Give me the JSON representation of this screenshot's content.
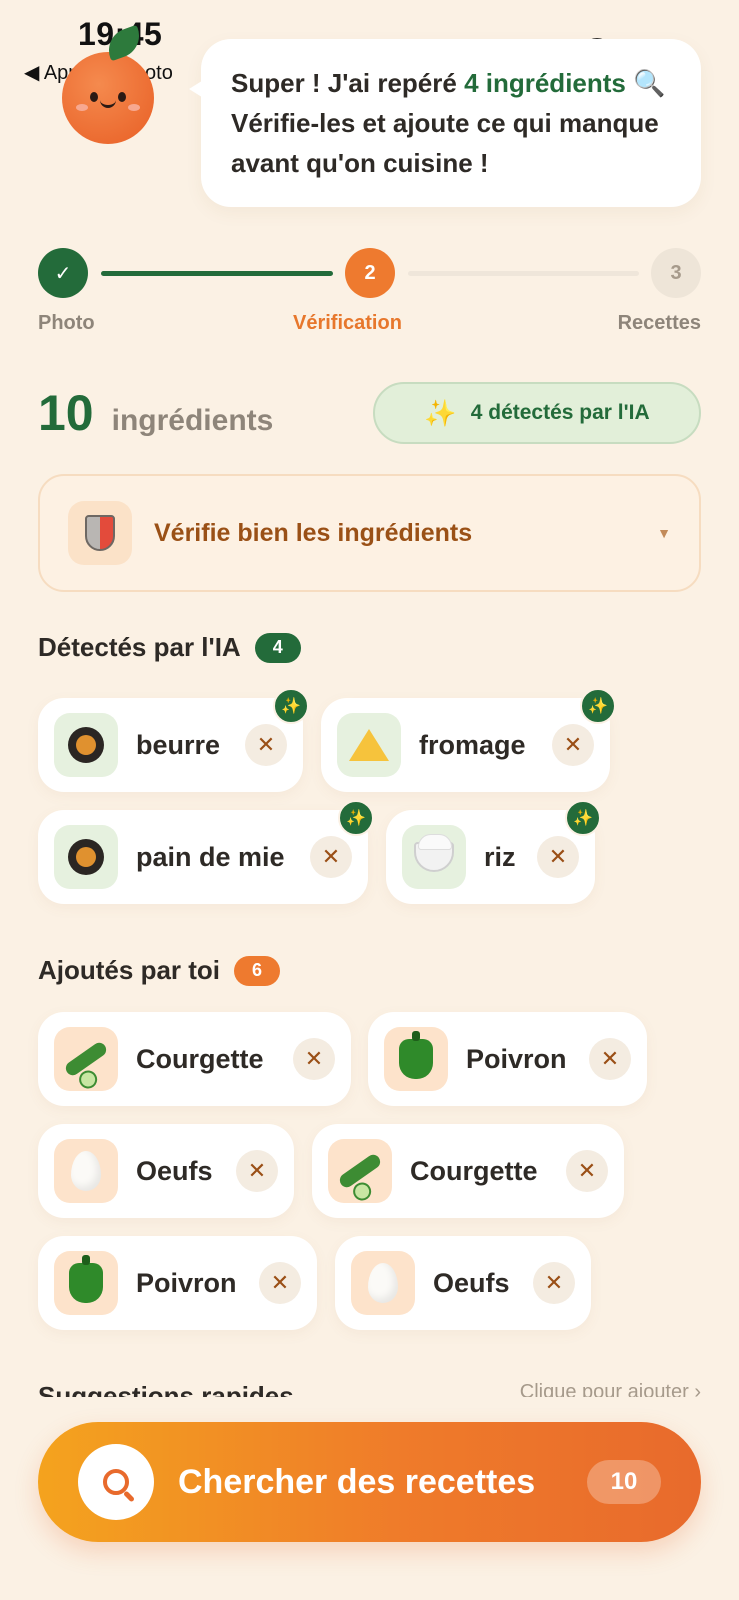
{
  "status_bar": {
    "time": "19:45",
    "back_label": "◀ Appareil photo"
  },
  "bubble": {
    "before": "Super ! J'ai repéré ",
    "highlight": "4 ingrédients",
    "line2_icon": "🔍",
    "after": " Vérifie-les et ajoute ce qui manque avant qu'on cuisine !"
  },
  "stepper": {
    "steps": [
      {
        "label": "Photo",
        "marker": "✓",
        "state": "done"
      },
      {
        "label": "Vérification",
        "marker": "2",
        "state": "active"
      },
      {
        "label": "Recettes",
        "marker": "3",
        "state": "pending"
      }
    ]
  },
  "summary": {
    "count": "10",
    "count_label": "ingrédients",
    "ai_pill_icon": "✨",
    "ai_pill": "4 détectés par l'IA"
  },
  "warning": {
    "label": "Vérifie bien les ingrédients",
    "caret": "▼"
  },
  "detected": {
    "title": "Détectés par l'IA",
    "badge": "4",
    "items": [
      {
        "label": "beurre",
        "icon": "pan-icon"
      },
      {
        "label": "fromage",
        "icon": "cheese-icon"
      },
      {
        "label": "pain de mie",
        "icon": "pan-icon"
      },
      {
        "label": "riz",
        "icon": "rice-bowl-icon"
      }
    ]
  },
  "added": {
    "title": "Ajoutés par toi",
    "badge": "6",
    "items": [
      {
        "label": "Courgette",
        "icon": "zucchini-icon"
      },
      {
        "label": "Poivron",
        "icon": "pepper-icon"
      },
      {
        "label": "Oeufs",
        "icon": "egg-icon"
      },
      {
        "label": "Courgette",
        "icon": "zucchini-icon"
      },
      {
        "label": "Poivron",
        "icon": "pepper-icon"
      },
      {
        "label": "Oeufs",
        "icon": "egg-icon"
      }
    ]
  },
  "suggestions": {
    "title": "Suggestions rapides",
    "link": "Clique pour ajouter ›"
  },
  "cta": {
    "label": "Chercher des recettes",
    "count": "10"
  },
  "remove_glyph": "✕",
  "colors": {
    "brand_green": "#236b3a",
    "brand_orange": "#ee7a2f",
    "background": "#fbf1e4"
  }
}
